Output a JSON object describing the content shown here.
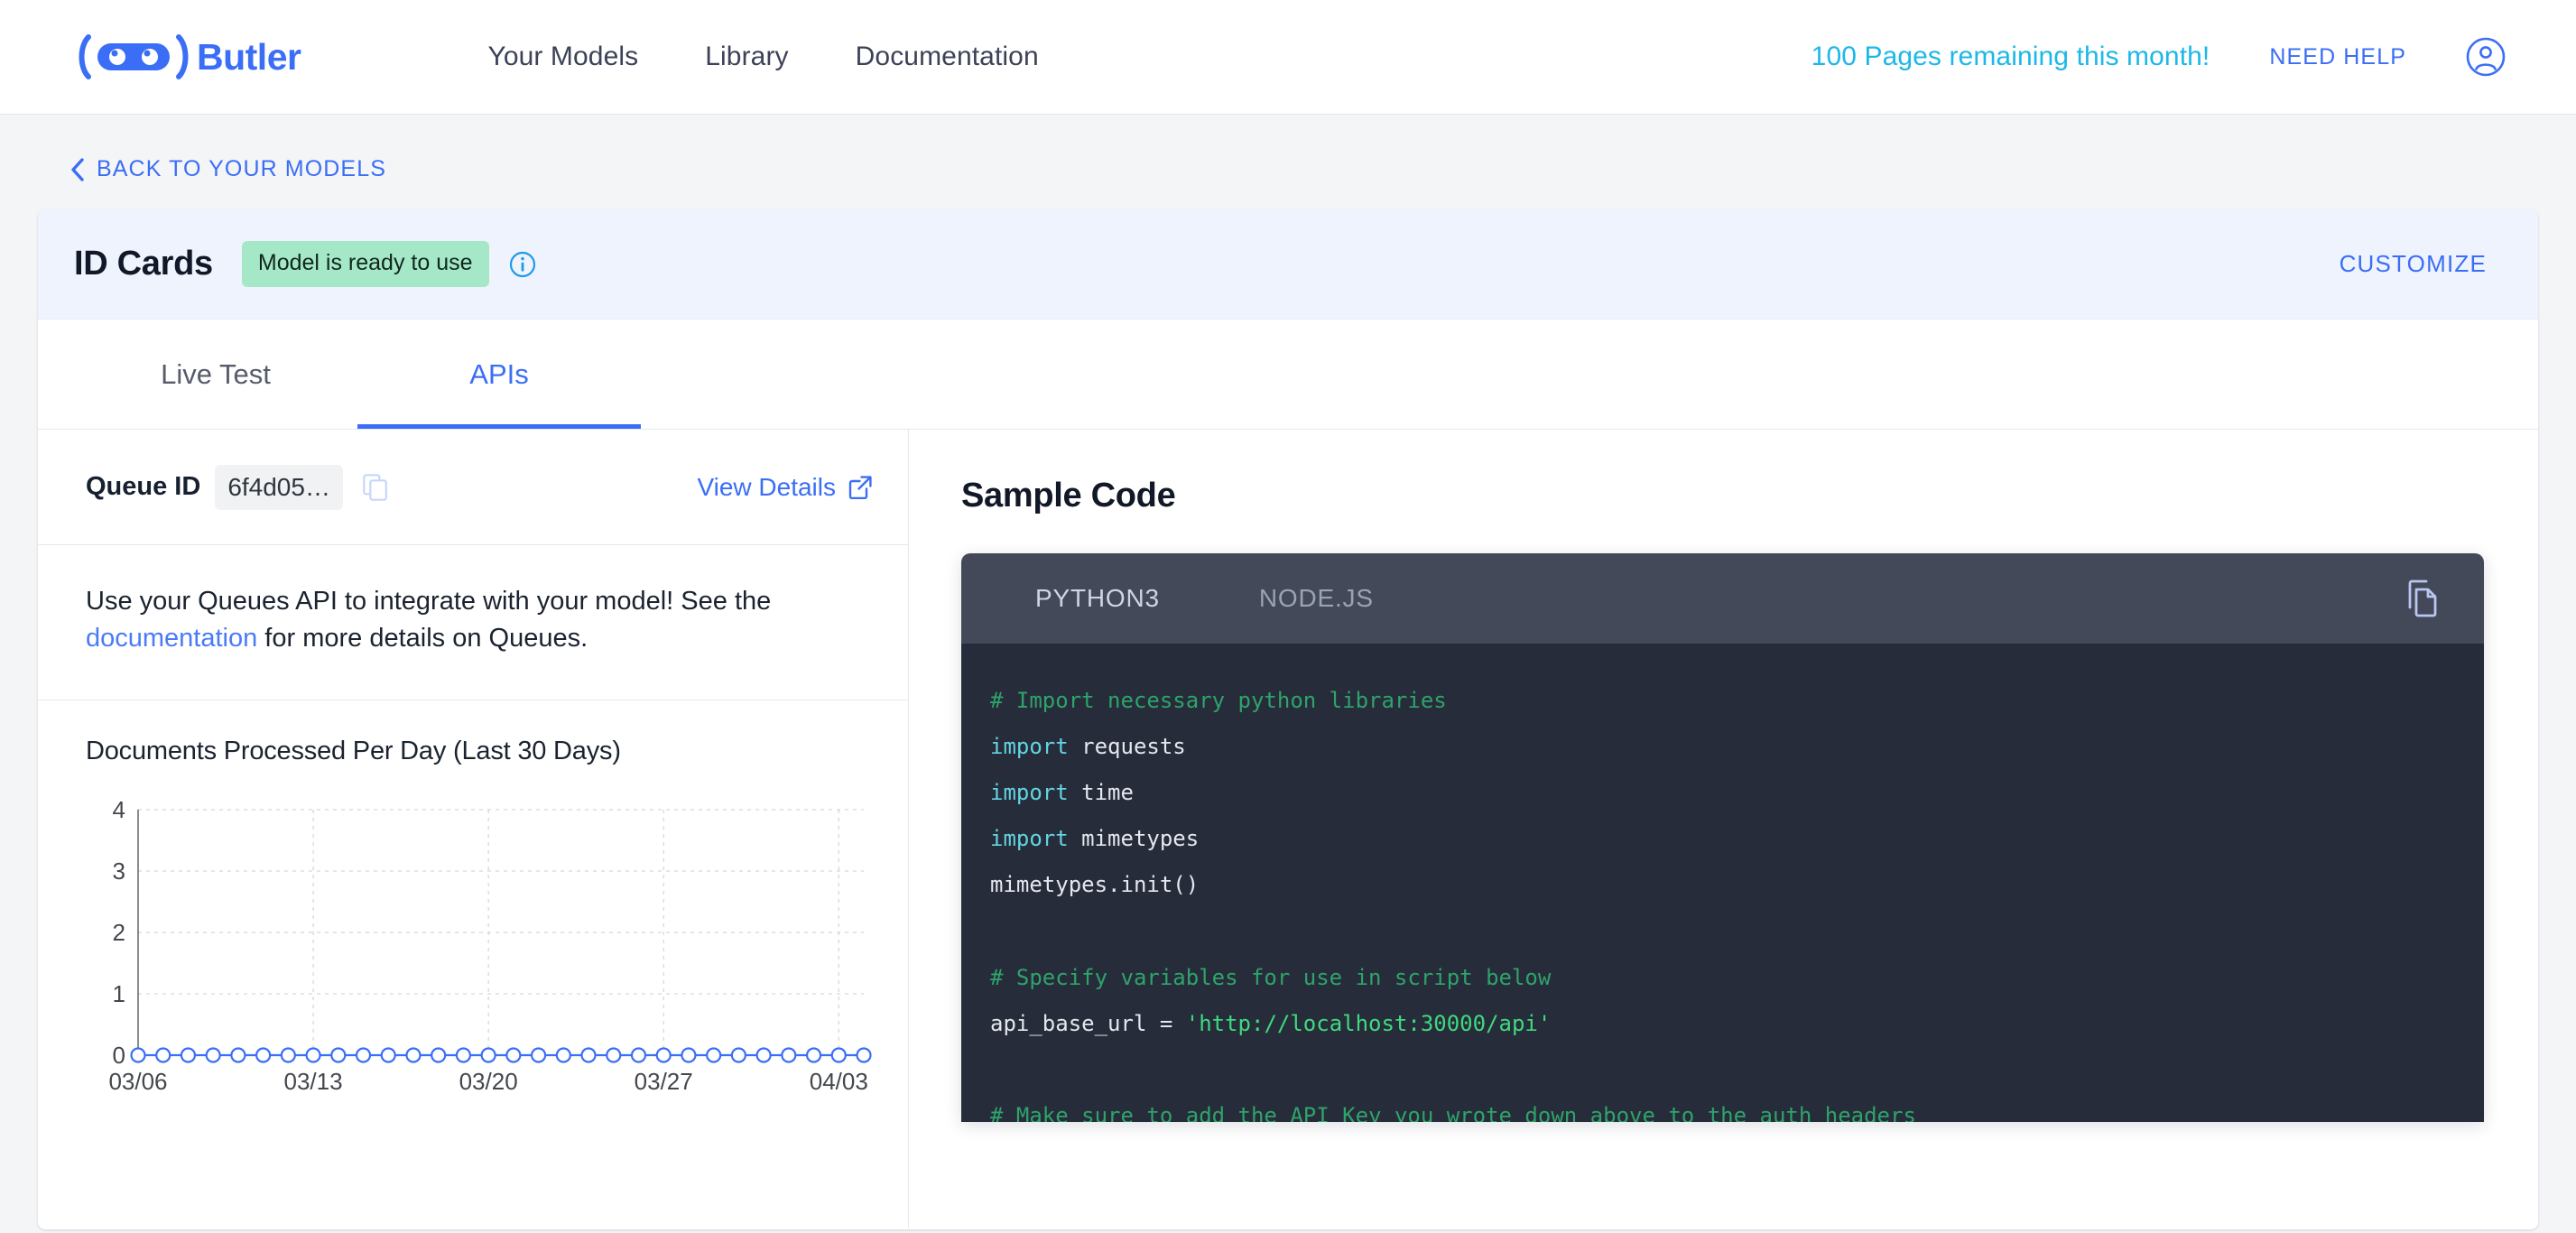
{
  "nav": {
    "brand": "Butler",
    "links": [
      "Your Models",
      "Library",
      "Documentation"
    ],
    "pages_remaining": "100 Pages remaining this month!",
    "need_help": "NEED HELP"
  },
  "back_link": "BACK TO YOUR MODELS",
  "card": {
    "title": "ID Cards",
    "status_badge": "Model is ready to use",
    "customize": "CUSTOMIZE",
    "tabs": [
      {
        "label": "Live Test",
        "active": false
      },
      {
        "label": "APIs",
        "active": true
      }
    ]
  },
  "queue": {
    "label": "Queue ID",
    "value": "6f4d05…",
    "view_details": "View Details"
  },
  "description": {
    "before": "Use your Queues API to integrate with your model! See the ",
    "link": "documentation",
    "after": " for more details on Queues."
  },
  "sample_code": {
    "heading": "Sample Code",
    "tabs": [
      {
        "label": "PYTHON3",
        "active": true
      },
      {
        "label": "NODE.JS",
        "active": false
      }
    ],
    "lines": [
      {
        "type": "comment",
        "text": "# Import necessary python libraries"
      },
      {
        "type": "import",
        "keyword": "import",
        "rest": " requests"
      },
      {
        "type": "import",
        "keyword": "import",
        "rest": " time"
      },
      {
        "type": "import",
        "keyword": "import",
        "rest": " mimetypes"
      },
      {
        "type": "plain",
        "text": "mimetypes.init()"
      },
      {
        "type": "blank",
        "text": ""
      },
      {
        "type": "comment",
        "text": "# Specify variables for use in script below"
      },
      {
        "type": "assign",
        "name": "api_base_url = ",
        "string": "'http://localhost:30000/api'"
      },
      {
        "type": "blank",
        "text": ""
      },
      {
        "type": "comment",
        "text": "# Make sure to add the API Key you wrote down above to the auth headers"
      }
    ]
  },
  "colors": {
    "brand_blue": "#3b6ef6",
    "cyan": "#1cb8e8",
    "badge_green": "#a5e8c8",
    "code_bg": "#272c3a",
    "code_header_bg": "#434959",
    "chart_line": "#3b6ef6"
  },
  "chart_data": {
    "type": "line",
    "title": "Documents Processed Per Day (Last 30 Days)",
    "xlabel": "",
    "ylabel": "",
    "ylim": [
      0,
      4
    ],
    "yticks": [
      0,
      1,
      2,
      3,
      4
    ],
    "grid": true,
    "legend": false,
    "xtick_labels": [
      "03/06",
      "03/13",
      "03/20",
      "03/27",
      "04/03"
    ],
    "x": [
      "03/06",
      "03/07",
      "03/08",
      "03/09",
      "03/10",
      "03/11",
      "03/12",
      "03/13",
      "03/14",
      "03/15",
      "03/16",
      "03/17",
      "03/18",
      "03/19",
      "03/20",
      "03/21",
      "03/22",
      "03/23",
      "03/24",
      "03/25",
      "03/26",
      "03/27",
      "03/28",
      "03/29",
      "03/30",
      "03/31",
      "04/01",
      "04/02",
      "04/03",
      "04/04"
    ],
    "values": [
      0,
      0,
      0,
      0,
      0,
      0,
      0,
      0,
      0,
      0,
      0,
      0,
      0,
      0,
      0,
      0,
      0,
      0,
      0,
      0,
      0,
      0,
      0,
      0,
      0,
      0,
      0,
      0,
      0,
      0
    ],
    "series": [
      {
        "name": "Documents Processed",
        "values": [
          0,
          0,
          0,
          0,
          0,
          0,
          0,
          0,
          0,
          0,
          0,
          0,
          0,
          0,
          0,
          0,
          0,
          0,
          0,
          0,
          0,
          0,
          0,
          0,
          0,
          0,
          0,
          0,
          0,
          0
        ]
      }
    ]
  }
}
